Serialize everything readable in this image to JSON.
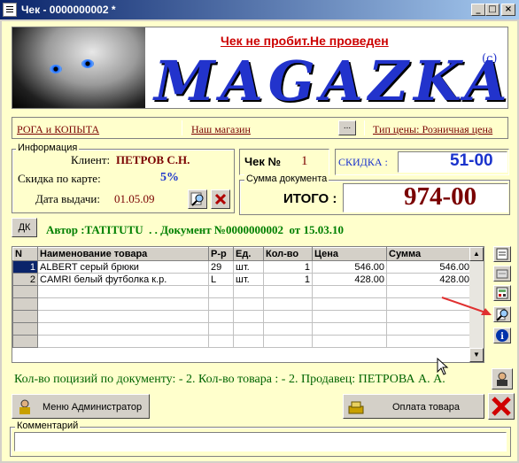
{
  "window": {
    "title": "Чек - 0000000002 *",
    "min": "_",
    "max": "□",
    "close": "×"
  },
  "banner": {
    "notice": "Чек не пробит.Не проведен",
    "logo": "MAGAZKA",
    "copyright": "(c)"
  },
  "links": {
    "company": "РОГА и КОПЫТА",
    "store": "Наш магазин",
    "browse": "...",
    "price_type": "Тип цены: Розничная цена"
  },
  "info": {
    "group_label": "Информация",
    "client_label": "Клиент:",
    "client_value": "ПЕТРОВ С.Н.",
    "discount_label": "Скидка по карте:",
    "discount_value": "5%",
    "date_label": "Дата выдачи:",
    "date_value": "01.05.09"
  },
  "receipt": {
    "label": "Чек №",
    "number": "1"
  },
  "discount_box": {
    "label": "СКИДКА :",
    "value": "51-00"
  },
  "sum": {
    "group_label": "Сумма документа",
    "label": "ИТОГО :",
    "value": "974-00"
  },
  "dk": {
    "label": "ДК"
  },
  "author_line": "Автор :TATITUTU  . . Документ №0000000002  от 15.03.10",
  "grid": {
    "columns": [
      "N",
      "Наименование товара",
      "Р-р",
      "Ед.",
      "Кол-во",
      "Цена",
      "Сумма"
    ],
    "rows": [
      [
        "1",
        "ALBERT серый брюки",
        "29",
        "шт.",
        "1",
        "546.00",
        "546.00"
      ],
      [
        "2",
        "CAMRI белый футболка к.р.",
        "L",
        "шт.",
        "1",
        "428.00",
        "428.00"
      ]
    ]
  },
  "summary": "Кол-во поцизий по документу: - 2. Кол-во товара : - 2. Продавец: ПЕТРОВА А. А.",
  "buttons": {
    "admin": "Меню Администратор",
    "pay": "Оплата товара"
  },
  "comment": {
    "label": "Комментарий",
    "value": ""
  },
  "icons": [
    "window-menu-icon",
    "magnify-icon",
    "delete-icon",
    "document-icon",
    "folder-icon",
    "calculator-icon",
    "search-icon",
    "info-icon",
    "user-icon",
    "close-icon",
    "admin-icon",
    "payment-icon"
  ]
}
